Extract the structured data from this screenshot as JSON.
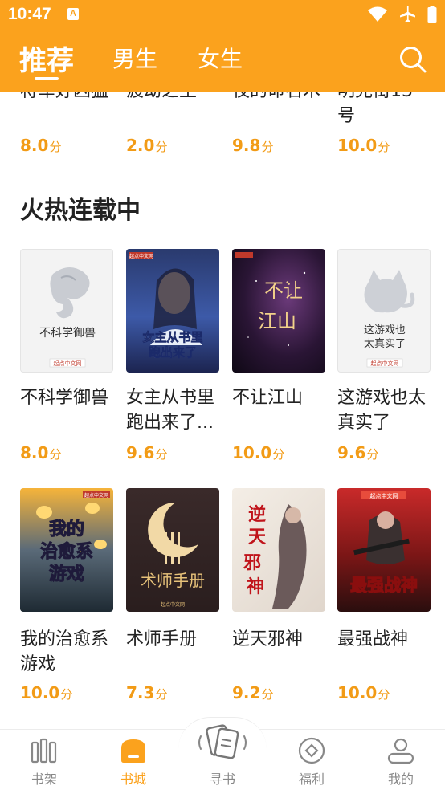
{
  "status": {
    "time": "10:47",
    "sim_badge": "A"
  },
  "colors": {
    "accent": "#fba21d",
    "score": "#f29b16"
  },
  "tabs": [
    {
      "label": "推荐",
      "active": true
    },
    {
      "label": "男生",
      "active": false
    },
    {
      "label": "女生",
      "active": false
    }
  ],
  "prev_row": [
    {
      "title_tail": "将军好凶猛",
      "score": "8.0",
      "unit": "分"
    },
    {
      "title_tail": "渡劫之王",
      "score": "2.0",
      "unit": "分"
    },
    {
      "title_tail": "夜的命名术",
      "score": "9.8",
      "unit": "分"
    },
    {
      "title_tail": "明克街13",
      "title_line2": "号",
      "score": "10.0",
      "unit": "分"
    }
  ],
  "section": {
    "title": "火热连载中"
  },
  "books": [
    {
      "title": "不科学御兽",
      "score": "8.0",
      "unit": "分",
      "cover_text": "不科学御兽",
      "cover_pub": "起点中文网",
      "cover_icon": "dragon-icon"
    },
    {
      "title": "女主从书里跑出来了...",
      "line1": "女主从书里",
      "line2": "跑出来了...",
      "score": "9.6",
      "unit": "分",
      "cover_text": "女主从书里跑出来了",
      "cover_pub": "起点中文网"
    },
    {
      "title": "不让江山",
      "score": "10.0",
      "unit": "分",
      "cover_text": "不让江山"
    },
    {
      "title": "这游戏也太真实了",
      "line1": "这游戏也太",
      "line2": "真实了",
      "score": "9.6",
      "unit": "分",
      "cover_text_1": "这游戏也",
      "cover_text_2": "太真实了",
      "cover_pub": "起点中文网",
      "cover_icon": "cat-icon"
    },
    {
      "title": "我的治愈系游戏",
      "line1": "我的治愈系",
      "line2": "游戏",
      "score": "10.0",
      "unit": "分",
      "cover_text": "我的治愈系游戏",
      "cover_pub": "起点中文网"
    },
    {
      "title": "术师手册",
      "score": "7.3",
      "unit": "分",
      "cover_text": "术师手册",
      "cover_pub": "起点中文网"
    },
    {
      "title": "逆天邪神",
      "score": "9.2",
      "unit": "分",
      "cover_text": "逆天邪神"
    },
    {
      "title": "最强战神",
      "score": "10.0",
      "unit": "分",
      "cover_text": "最强战神",
      "cover_pub": "起点中文网"
    }
  ],
  "nav": [
    {
      "label": "书架",
      "icon": "bookshelf-icon",
      "active": false
    },
    {
      "label": "书城",
      "icon": "bookstore-icon",
      "active": true
    },
    {
      "label": "寻书",
      "icon": "find-book-icon",
      "active": false
    },
    {
      "label": "福利",
      "icon": "welfare-icon",
      "active": false
    },
    {
      "label": "我的",
      "icon": "profile-icon",
      "active": false
    }
  ]
}
